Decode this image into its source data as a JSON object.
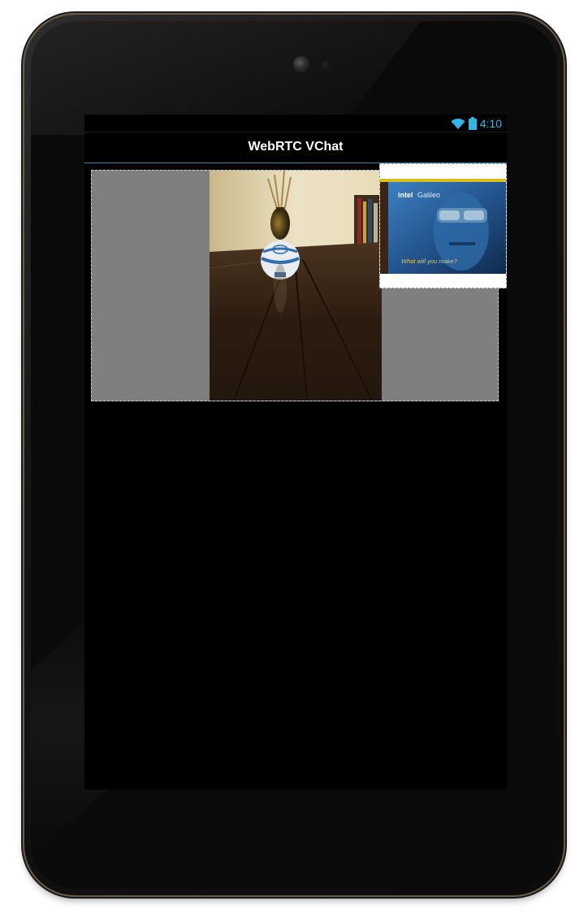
{
  "status_bar": {
    "time": "4:10",
    "icons": [
      "wifi-icon",
      "battery-icon"
    ],
    "accent_color": "#33b5e5"
  },
  "action_bar": {
    "title": "WebRTC VChat",
    "divider_color": "#2f84a8"
  },
  "video": {
    "remote_placeholder_color": "#7f7f7f",
    "local_poster": {
      "brand": "intel",
      "product": "Galileo",
      "tagline": "What will you make?"
    }
  }
}
